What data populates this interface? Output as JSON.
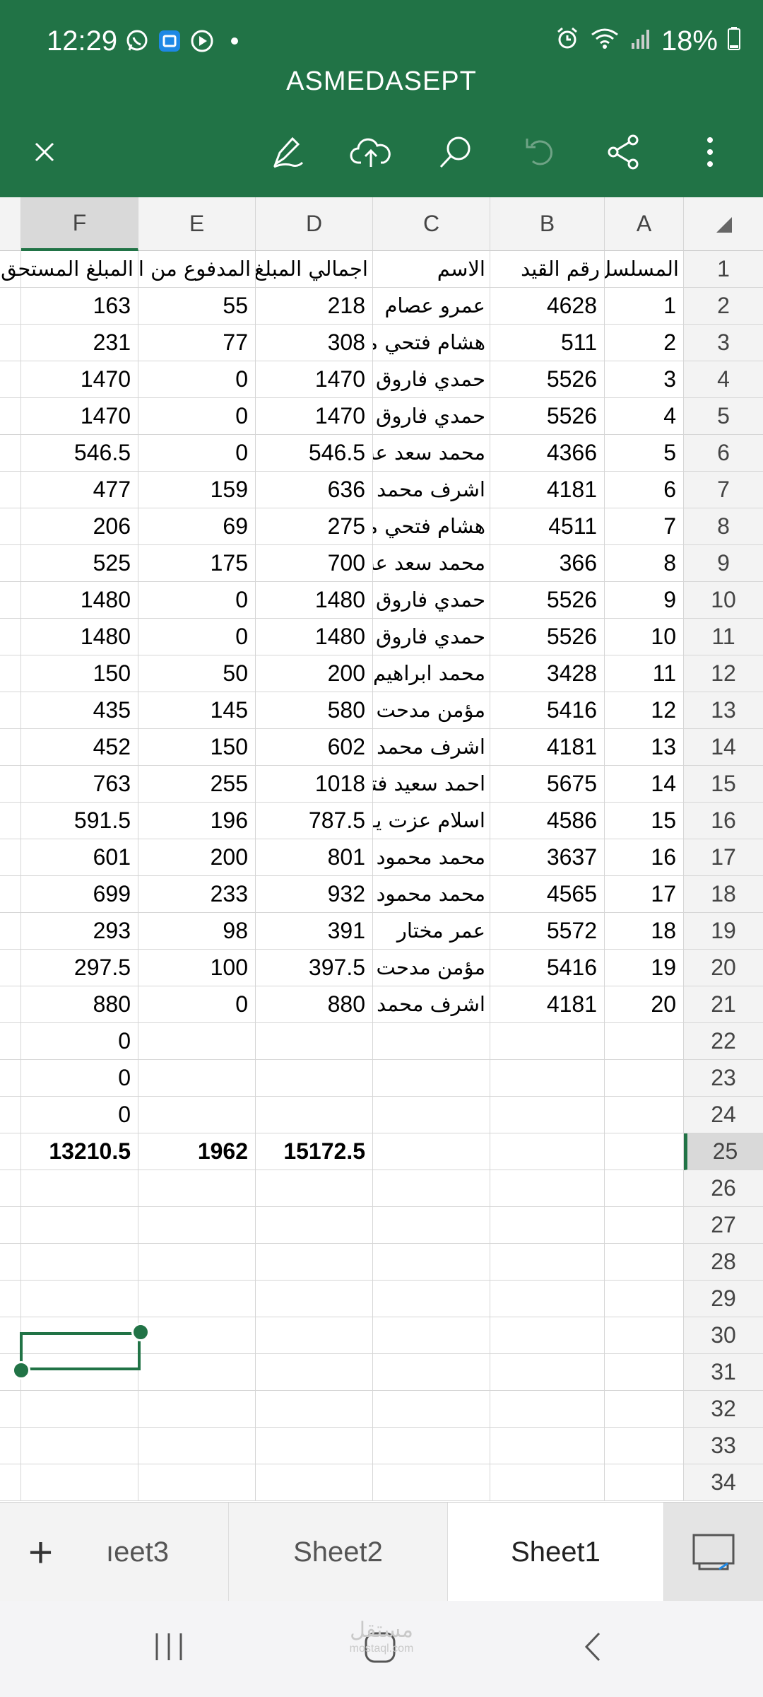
{
  "status_bar": {
    "time": "12:29",
    "battery": "18%"
  },
  "app": {
    "title": "ASMEDASEPT"
  },
  "toolbar": {
    "icons": [
      "close-icon",
      "draw-pen-icon",
      "cloud-upload-icon",
      "search-icon",
      "undo-icon",
      "share-icon",
      "more-icon"
    ]
  },
  "columns": [
    "F",
    "E",
    "D",
    "C",
    "B",
    "A"
  ],
  "selected_column": "F",
  "rows": [
    {
      "n": "1",
      "F": "المبلغ المستحق",
      "E": "المدفوع من العا",
      "D": "اجمالي المبلغ",
      "C": "الاسم",
      "B": "رقم القيد",
      "A": "المسلسل"
    },
    {
      "n": "2",
      "F": "163",
      "E": "55",
      "D": "218",
      "C": "عمرو عصام",
      "B": "4628",
      "A": "1"
    },
    {
      "n": "3",
      "F": "231",
      "E": "77",
      "D": "308",
      "C": "هشام فتحي مـ",
      "B": "511",
      "A": "2"
    },
    {
      "n": "4",
      "F": "1470",
      "E": "0",
      "D": "1470",
      "C": "حمدي فاروق",
      "B": "5526",
      "A": "3"
    },
    {
      "n": "5",
      "F": "1470",
      "E": "0",
      "D": "1470",
      "C": "حمدي فاروق",
      "B": "5526",
      "A": "4"
    },
    {
      "n": "6",
      "F": "546.5",
      "E": "0",
      "D": "546.5",
      "C": "محمد سعد عبـ",
      "B": "4366",
      "A": "5"
    },
    {
      "n": "7",
      "F": "477",
      "E": "159",
      "D": "636",
      "C": "اشرف محمد",
      "B": "4181",
      "A": "6"
    },
    {
      "n": "8",
      "F": "206",
      "E": "69",
      "D": "275",
      "C": "هشام فتحي مـ",
      "B": "4511",
      "A": "7"
    },
    {
      "n": "9",
      "F": "525",
      "E": "175",
      "D": "700",
      "C": "محمد سعد عبـ",
      "B": "366",
      "A": "8"
    },
    {
      "n": "10",
      "F": "1480",
      "E": "0",
      "D": "1480",
      "C": "حمدي فاروق",
      "B": "5526",
      "A": "9"
    },
    {
      "n": "11",
      "F": "1480",
      "E": "0",
      "D": "1480",
      "C": "حمدي فاروق",
      "B": "5526",
      "A": "10"
    },
    {
      "n": "12",
      "F": "150",
      "E": "50",
      "D": "200",
      "C": "محمد ابراهيم",
      "B": "3428",
      "A": "11"
    },
    {
      "n": "13",
      "F": "435",
      "E": "145",
      "D": "580",
      "C": "مؤمن مدحت",
      "B": "5416",
      "A": "12"
    },
    {
      "n": "14",
      "F": "452",
      "E": "150",
      "D": "602",
      "C": "اشرف محمد",
      "B": "4181",
      "A": "13"
    },
    {
      "n": "15",
      "F": "763",
      "E": "255",
      "D": "1018",
      "C": "احمد سعيد فتـ",
      "B": "5675",
      "A": "14"
    },
    {
      "n": "16",
      "F": "591.5",
      "E": "196",
      "D": "787.5",
      "C": "اسلام عزت يـ",
      "B": "4586",
      "A": "15"
    },
    {
      "n": "17",
      "F": "601",
      "E": "200",
      "D": "801",
      "C": "محمد محمود",
      "B": "3637",
      "A": "16"
    },
    {
      "n": "18",
      "F": "699",
      "E": "233",
      "D": "932",
      "C": "محمد محمود",
      "B": "4565",
      "A": "17"
    },
    {
      "n": "19",
      "F": "293",
      "E": "98",
      "D": "391",
      "C": "عمر مختار",
      "B": "5572",
      "A": "18"
    },
    {
      "n": "20",
      "F": "297.5",
      "E": "100",
      "D": "397.5",
      "C": "مؤمن مدحت",
      "B": "5416",
      "A": "19"
    },
    {
      "n": "21",
      "F": "880",
      "E": "0",
      "D": "880",
      "C": "اشرف محمد",
      "B": "4181",
      "A": "20"
    },
    {
      "n": "22",
      "F": "0",
      "E": "",
      "D": "",
      "C": "",
      "B": "",
      "A": ""
    },
    {
      "n": "23",
      "F": "0",
      "E": "",
      "D": "",
      "C": "",
      "B": "",
      "A": ""
    },
    {
      "n": "24",
      "F": "0",
      "E": "",
      "D": "",
      "C": "",
      "B": "",
      "A": ""
    },
    {
      "n": "25",
      "F": "13210.5",
      "E": "1962",
      "D": "15172.5",
      "C": "",
      "B": "",
      "A": "",
      "total": true
    },
    {
      "n": "26",
      "F": "",
      "E": "",
      "D": "",
      "C": "",
      "B": "",
      "A": ""
    },
    {
      "n": "27",
      "F": "",
      "E": "",
      "D": "",
      "C": "",
      "B": "",
      "A": ""
    },
    {
      "n": "28",
      "F": "",
      "E": "",
      "D": "",
      "C": "",
      "B": "",
      "A": ""
    },
    {
      "n": "29",
      "F": "",
      "E": "",
      "D": "",
      "C": "",
      "B": "",
      "A": ""
    },
    {
      "n": "30",
      "F": "",
      "E": "",
      "D": "",
      "C": "",
      "B": "",
      "A": ""
    },
    {
      "n": "31",
      "F": "",
      "E": "",
      "D": "",
      "C": "",
      "B": "",
      "A": ""
    },
    {
      "n": "32",
      "F": "",
      "E": "",
      "D": "",
      "C": "",
      "B": "",
      "A": ""
    },
    {
      "n": "33",
      "F": "",
      "E": "",
      "D": "",
      "C": "",
      "B": "",
      "A": ""
    },
    {
      "n": "34",
      "F": "",
      "E": "",
      "D": "",
      "C": "",
      "B": "",
      "A": ""
    }
  ],
  "selected_row": "25",
  "text_columns": [
    "C"
  ],
  "sheet_tabs": {
    "add_label": "+",
    "tabs": [
      {
        "label": "ıeet3",
        "active": false
      },
      {
        "label": "Sheet2",
        "active": false
      },
      {
        "label": "Sheet1",
        "active": true
      }
    ]
  },
  "watermark": {
    "text": "مستقل",
    "sub": "mostaql.com"
  },
  "colors": {
    "header_green": "#217346",
    "selection": "#217346"
  }
}
